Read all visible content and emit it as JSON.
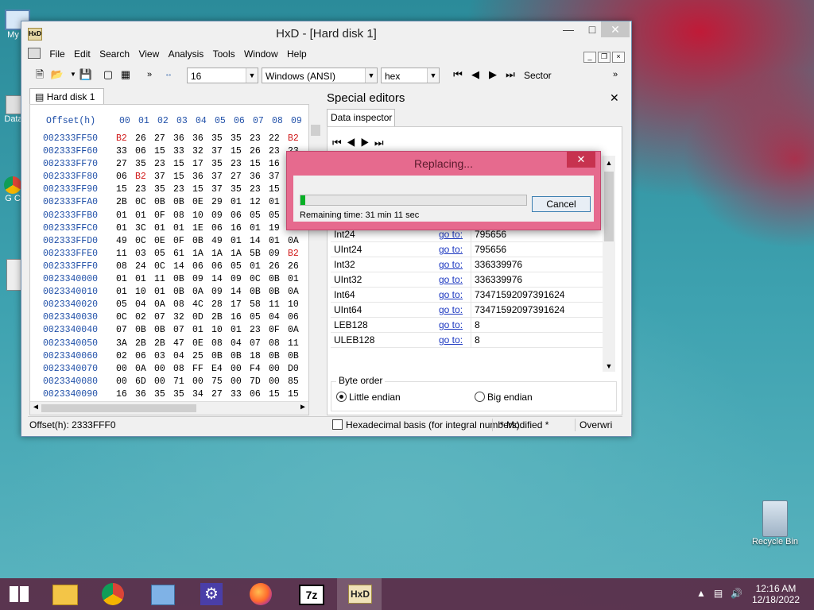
{
  "desktop": {
    "icons": [
      {
        "label": "My C",
        "id": "computer"
      },
      {
        "label": "Data",
        "id": "data"
      },
      {
        "label": "G C",
        "id": "chrome"
      },
      {
        "label": "",
        "id": "hxd"
      }
    ],
    "recycle_bin": "Recycle Bin"
  },
  "window": {
    "title": "HxD - [Hard disk 1]",
    "menu": [
      "File",
      "Edit",
      "Search",
      "View",
      "Analysis",
      "Tools",
      "Window",
      "Help"
    ],
    "toolbar": {
      "bytes_per_row": "16",
      "charset": "Windows (ANSI)",
      "display": "hex",
      "sector_label": "Sector",
      "chevron": "»"
    },
    "doc_tab": "Hard disk 1",
    "hex": {
      "header_label": "Offset(h)",
      "columns": [
        "00",
        "01",
        "02",
        "03",
        "04",
        "05",
        "06",
        "07",
        "08",
        "09"
      ],
      "rows": [
        {
          "offset": "002333FF50",
          "bytes": [
            "B2",
            "26",
            "27",
            "36",
            "36",
            "35",
            "35",
            "23",
            "22",
            "B2"
          ],
          "red": [
            0,
            9
          ]
        },
        {
          "offset": "002333FF60",
          "bytes": [
            "33",
            "06",
            "15",
            "33",
            "32",
            "37",
            "15",
            "26",
            "23",
            "23"
          ],
          "red": []
        },
        {
          "offset": "002333FF70",
          "bytes": [
            "27",
            "35",
            "23",
            "15",
            "17",
            "35",
            "23",
            "15",
            "16",
            ""
          ],
          "red": []
        },
        {
          "offset": "002333FF80",
          "bytes": [
            "06",
            "B2",
            "37",
            "15",
            "36",
            "37",
            "27",
            "36",
            "37",
            ""
          ],
          "red": [
            1
          ]
        },
        {
          "offset": "002333FF90",
          "bytes": [
            "15",
            "23",
            "35",
            "23",
            "15",
            "37",
            "35",
            "23",
            "15",
            ""
          ],
          "red": []
        },
        {
          "offset": "002333FFA0",
          "bytes": [
            "2B",
            "0C",
            "0B",
            "0B",
            "0E",
            "29",
            "01",
            "12",
            "01",
            ""
          ],
          "red": []
        },
        {
          "offset": "002333FFB0",
          "bytes": [
            "01",
            "01",
            "0F",
            "08",
            "10",
            "09",
            "06",
            "05",
            "05",
            ""
          ],
          "red": []
        },
        {
          "offset": "002333FFC0",
          "bytes": [
            "01",
            "3C",
            "01",
            "01",
            "1E",
            "06",
            "16",
            "01",
            "19",
            ""
          ],
          "red": []
        },
        {
          "offset": "002333FFD0",
          "bytes": [
            "49",
            "0C",
            "0E",
            "0F",
            "0B",
            "49",
            "01",
            "14",
            "01",
            "0A"
          ],
          "red": []
        },
        {
          "offset": "002333FFE0",
          "bytes": [
            "11",
            "03",
            "05",
            "61",
            "1A",
            "1A",
            "1A",
            "5B",
            "09",
            "B2"
          ],
          "red": [
            9
          ]
        },
        {
          "offset": "002333FFF0",
          "bytes": [
            "08",
            "24",
            "0C",
            "14",
            "06",
            "06",
            "05",
            "01",
            "26",
            "26"
          ],
          "red": []
        },
        {
          "offset": "0023340000",
          "bytes": [
            "01",
            "01",
            "11",
            "0B",
            "09",
            "14",
            "09",
            "0C",
            "0B",
            "01"
          ],
          "red": []
        },
        {
          "offset": "0023340010",
          "bytes": [
            "01",
            "10",
            "01",
            "0B",
            "0A",
            "09",
            "14",
            "0B",
            "0B",
            "0A"
          ],
          "red": []
        },
        {
          "offset": "0023340020",
          "bytes": [
            "05",
            "04",
            "0A",
            "08",
            "4C",
            "28",
            "17",
            "58",
            "11",
            "10"
          ],
          "red": []
        },
        {
          "offset": "0023340030",
          "bytes": [
            "0C",
            "02",
            "07",
            "32",
            "0D",
            "2B",
            "16",
            "05",
            "04",
            "06"
          ],
          "red": []
        },
        {
          "offset": "0023340040",
          "bytes": [
            "07",
            "0B",
            "0B",
            "07",
            "01",
            "10",
            "01",
            "23",
            "0F",
            "0A"
          ],
          "red": []
        },
        {
          "offset": "0023340050",
          "bytes": [
            "3A",
            "2B",
            "2B",
            "47",
            "0E",
            "08",
            "04",
            "07",
            "08",
            "11"
          ],
          "red": []
        },
        {
          "offset": "0023340060",
          "bytes": [
            "02",
            "06",
            "03",
            "04",
            "25",
            "0B",
            "0B",
            "18",
            "0B",
            "0B"
          ],
          "red": []
        },
        {
          "offset": "0023340070",
          "bytes": [
            "00",
            "0A",
            "00",
            "08",
            "FF",
            "E4",
            "00",
            "F4",
            "00",
            "D0"
          ],
          "red": []
        },
        {
          "offset": "0023340080",
          "bytes": [
            "00",
            "6D",
            "00",
            "71",
            "00",
            "75",
            "00",
            "7D",
            "00",
            "85"
          ],
          "red": []
        },
        {
          "offset": "0023340090",
          "bytes": [
            "16",
            "36",
            "35",
            "35",
            "34",
            "27",
            "33",
            "06",
            "15",
            "15"
          ],
          "red": []
        }
      ]
    },
    "special_editors": {
      "title": "Special editors",
      "tab": "Data inspector",
      "goto_label": "go to:",
      "rows": [
        {
          "name": "Int24",
          "value": "795656"
        },
        {
          "name": "UInt24",
          "value": "795656"
        },
        {
          "name": "Int32",
          "value": "336339976"
        },
        {
          "name": "UInt32",
          "value": "336339976"
        },
        {
          "name": "Int64",
          "value": "73471592097391624"
        },
        {
          "name": "UInt64",
          "value": "73471592097391624"
        },
        {
          "name": "LEB128",
          "value": "8"
        },
        {
          "name": "ULEB128",
          "value": "8"
        }
      ],
      "byte_order_label": "Byte order",
      "little_endian": "Little endian",
      "big_endian": "Big endian",
      "hex_basis": "Hexadecimal basis (for integral numbers)"
    },
    "status": {
      "offset": "Offset(h): 2333FFF0",
      "modified": "* Modified *",
      "mode": "Overwri"
    }
  },
  "dialog": {
    "title": "Replacing...",
    "cancel": "Cancel",
    "remaining": "Remaining time: 31 min 11 sec",
    "progress": 0.02
  },
  "taskbar": {
    "apps": [
      "start",
      "file-explorer",
      "chrome",
      "control-panel",
      "settings",
      "firefox",
      "7zip",
      "hxd"
    ],
    "time": "12:16 AM",
    "date": "12/18/2022"
  }
}
